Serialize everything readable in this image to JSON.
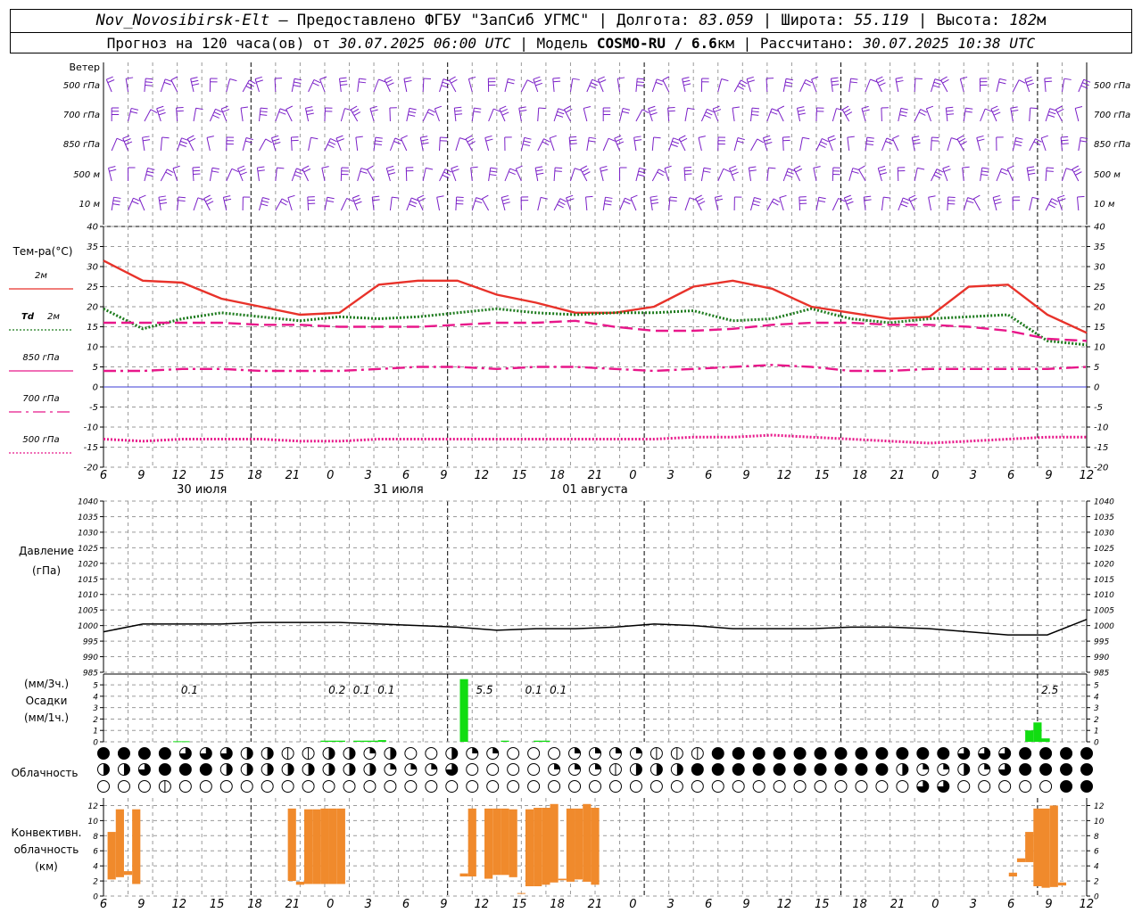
{
  "header": {
    "station": "Nov_Novosibirsk-Elt",
    "provided_by": "Предоставлено ФГБУ \"ЗапСиб УГМС\"",
    "lon_label": "Долгота:",
    "lon": "83.059",
    "lat_label": "Широта:",
    "lat": "55.119",
    "alt_label": "Высота:",
    "alt": "182",
    "alt_unit": "м",
    "forecast_label": "Прогноз на 120 часа(ов) от",
    "forecast_time": "30.07.2025 06:00 UTC",
    "model_label": "Модель",
    "model": "COSMO-RU / 6.6",
    "model_unit": "км",
    "computed_label": "Рассчитано:",
    "computed_time": "30.07.2025 10:38 UTC"
  },
  "chart_data": [
    {
      "type": "barbs",
      "title": "Ветер",
      "levels": [
        "500 гПа",
        "700 гПа",
        "850 гПа",
        "500 м",
        "10 м"
      ]
    },
    {
      "type": "line",
      "title": "Тем-ра(°C)",
      "ylim": [
        -20,
        40
      ],
      "yticks": [
        40,
        35,
        30,
        25,
        20,
        15,
        10,
        5,
        0,
        -5,
        -10,
        -15,
        -20
      ],
      "x_hours": [
        0,
        6,
        12,
        18,
        24,
        30,
        36,
        42,
        48,
        54,
        60,
        66,
        72,
        78,
        84,
        90,
        96,
        102,
        108,
        114,
        120
      ],
      "series": [
        {
          "name": "2м",
          "color": "#e8322a",
          "dash": "solid",
          "values": [
            31.5,
            26.5,
            26,
            22,
            20,
            18,
            18.5,
            25.5,
            26.5,
            26.5,
            23,
            21,
            18.5,
            18.5,
            20,
            25,
            26.5,
            24.5,
            20,
            18.5,
            17,
            17.5,
            25,
            25.5,
            18,
            13.5
          ]
        },
        {
          "name": "Td 2м",
          "color": "#1c7a1c",
          "dash": "dotted",
          "values": [
            19.5,
            14.5,
            17,
            18.5,
            17.5,
            16.5,
            17.5,
            17,
            17.5,
            18.5,
            19.5,
            18.5,
            18,
            18.5,
            18.5,
            19,
            16.5,
            17,
            19.5,
            17,
            16,
            17,
            17.5,
            18,
            11.5,
            10.5
          ]
        },
        {
          "name": "850 гПа",
          "color": "#e8178a",
          "dash": "longdash",
          "values": [
            16,
            16,
            16,
            16,
            15.5,
            15.5,
            15,
            15,
            15,
            15.5,
            16,
            16,
            16.5,
            15,
            14,
            14,
            14.5,
            15.5,
            16,
            16,
            15.5,
            15.5,
            15,
            14,
            12,
            11.5
          ]
        },
        {
          "name": "700 гПа",
          "color": "#e8178a",
          "dash": "dashdot",
          "values": [
            4,
            4,
            4.5,
            4.5,
            4,
            4,
            4,
            4.5,
            5,
            5,
            4.5,
            5,
            5,
            4.5,
            4,
            4.5,
            5,
            5.5,
            5,
            4,
            4,
            4.5,
            4.5,
            4.5,
            4.5,
            5
          ]
        },
        {
          "name": "500 гПа",
          "color": "#e8178a",
          "dash": "dotted",
          "values": [
            -13,
            -13.5,
            -13,
            -13,
            -13,
            -13.5,
            -13.5,
            -13,
            -13,
            -13,
            -13,
            -13,
            -13,
            -13,
            -13,
            -12.5,
            -12.5,
            -12,
            -12.5,
            -13,
            -13.5,
            -14,
            -13.5,
            -13,
            -12.5,
            -12.5
          ]
        }
      ]
    },
    {
      "type": "line",
      "title": "Давление",
      "unit": "(гПа)",
      "ylim": [
        985,
        1040
      ],
      "yticks": [
        1040,
        1035,
        1030,
        1025,
        1020,
        1015,
        1010,
        1005,
        1000,
        995,
        990,
        985
      ],
      "x_hours": [
        0,
        6,
        12,
        18,
        24,
        30,
        36,
        42,
        48,
        54,
        60,
        66,
        72,
        78,
        84,
        90,
        96,
        102,
        108,
        114,
        120
      ],
      "series": [
        {
          "name": "",
          "color": "#000000",
          "dash": "solid",
          "values": [
            998,
            1000.5,
            1000.5,
            1000.5,
            1001,
            1001,
            1001,
            1000.5,
            1000,
            999.5,
            998.5,
            999,
            999,
            999.5,
            1000.5,
            1000,
            999,
            999,
            999,
            999.5,
            999.5,
            999,
            998,
            997,
            997,
            1002
          ]
        }
      ]
    },
    {
      "type": "bar",
      "title": "Осадки",
      "units": [
        "(мм/3ч.)",
        "(мм/1ч.)"
      ],
      "ylim": [
        0,
        5
      ],
      "yticks": [
        5,
        4,
        3,
        2,
        1,
        0
      ],
      "bars": [
        {
          "hour": 9,
          "value": 0.05
        },
        {
          "hour": 10,
          "value": 0.05
        },
        {
          "hour": 27,
          "value": 0.1
        },
        {
          "hour": 28,
          "value": 0.1
        },
        {
          "hour": 29,
          "value": 0.1
        },
        {
          "hour": 31,
          "value": 0.1
        },
        {
          "hour": 32,
          "value": 0.1
        },
        {
          "hour": 33,
          "value": 0.1
        },
        {
          "hour": 34,
          "value": 0.15
        },
        {
          "hour": 44,
          "value": 5.5
        },
        {
          "hour": 49,
          "value": 0.1
        },
        {
          "hour": 53,
          "value": 0.1
        },
        {
          "hour": 54,
          "value": 0.1
        },
        {
          "hour": 113,
          "value": 1.0
        },
        {
          "hour": 114,
          "value": 1.7
        },
        {
          "hour": 115,
          "value": 0.3
        }
      ],
      "totals": [
        {
          "hour": 10.5,
          "label": "0.1"
        },
        {
          "hour": 28.5,
          "label": "0.2"
        },
        {
          "hour": 31.5,
          "label": "0.1"
        },
        {
          "hour": 34.5,
          "label": "0.1"
        },
        {
          "hour": 46.5,
          "label": "5.5"
        },
        {
          "hour": 52.5,
          "label": "0.1"
        },
        {
          "hour": 55.5,
          "label": "0.1"
        },
        {
          "hour": 115.5,
          "label": "2.5"
        }
      ]
    },
    {
      "type": "symbols",
      "title": "Облачность",
      "rows": [
        "CCCCDDDHHBBHHFHEEHFFEEEFFFFBBBCCCCCCCCCCCCDDDCCCCCCCCCCCCCCCCCCCCCCCCCCCCDFFHHEEEEEEDDDDDDDDCCBHEEEHH",
        "HHDCCCHHHHHHHHFFFDEEEEFFFBHHHCCCCCCCCCCHFFHFDCCCCCCCCCCCCCCCCCCCCCCCDDDCFFFFEEEDDHHBBHHHHCCCCCCCC",
        "EEEBEEEEEEEEEEEEEEEEEEEEEEEEEEEEEEEEEEEEDDEEEEECCCCCCCCDDDEHHHHCCCHHHHHCCCCEEEEEEEEEEEEEEEEEEEEEEEHHCCCCCCCC"
      ]
    },
    {
      "type": "bar",
      "title": "Конвективн. облачность",
      "unit": "(км)",
      "ylim": [
        0,
        13
      ],
      "yticks": [
        12,
        10,
        8,
        6,
        4,
        2,
        0
      ],
      "bars": [
        {
          "h0": 0.5,
          "h1": 1.5,
          "base": 2.2,
          "top": 8.5
        },
        {
          "h0": 1.5,
          "h1": 2.5,
          "base": 2.5,
          "top": 11.5
        },
        {
          "h0": 2.5,
          "h1": 3.5,
          "base": 2.8,
          "top": 3.3
        },
        {
          "h0": 3.5,
          "h1": 4.5,
          "base": 1.6,
          "top": 11.5
        },
        {
          "h0": 22.5,
          "h1": 23.5,
          "base": 2.0,
          "top": 11.6
        },
        {
          "h0": 23.5,
          "h1": 24.5,
          "base": 1.5,
          "top": 1.9
        },
        {
          "h0": 24.5,
          "h1": 25.5,
          "base": 1.6,
          "top": 11.5
        },
        {
          "h0": 25.5,
          "h1": 26.5,
          "base": 1.6,
          "top": 11.5
        },
        {
          "h0": 26.5,
          "h1": 27.5,
          "base": 1.6,
          "top": 11.6
        },
        {
          "h0": 27.5,
          "h1": 28.5,
          "base": 1.6,
          "top": 11.6
        },
        {
          "h0": 28.5,
          "h1": 29.5,
          "base": 1.6,
          "top": 11.6
        },
        {
          "h0": 43.5,
          "h1": 44.5,
          "base": 2.6,
          "top": 3.0
        },
        {
          "h0": 44.5,
          "h1": 45.5,
          "base": 2.6,
          "top": 11.6
        },
        {
          "h0": 46.5,
          "h1": 47.5,
          "base": 2.3,
          "top": 11.6
        },
        {
          "h0": 47.5,
          "h1": 48.5,
          "base": 2.8,
          "top": 11.6
        },
        {
          "h0": 48.5,
          "h1": 49.5,
          "base": 2.8,
          "top": 11.6
        },
        {
          "h0": 49.5,
          "h1": 50.5,
          "base": 2.5,
          "top": 11.5
        },
        {
          "h0": 50.5,
          "h1": 51.5,
          "base": 0.3,
          "top": 0.4
        },
        {
          "h0": 51.5,
          "h1": 52.5,
          "base": 1.3,
          "top": 11.5
        },
        {
          "h0": 52.5,
          "h1": 53.5,
          "base": 1.3,
          "top": 11.7
        },
        {
          "h0": 53.5,
          "h1": 54.5,
          "base": 1.5,
          "top": 11.7
        },
        {
          "h0": 54.5,
          "h1": 55.5,
          "base": 1.8,
          "top": 12.2
        },
        {
          "h0": 55.5,
          "h1": 56.5,
          "base": 2.1,
          "top": 2.3
        },
        {
          "h0": 56.5,
          "h1": 57.5,
          "base": 1.9,
          "top": 11.6
        },
        {
          "h0": 57.5,
          "h1": 58.5,
          "base": 2.2,
          "top": 11.6
        },
        {
          "h0": 58.5,
          "h1": 59.5,
          "base": 1.9,
          "top": 12.2
        },
        {
          "h0": 59.5,
          "h1": 60.5,
          "base": 1.5,
          "top": 11.7
        },
        {
          "h0": 110.5,
          "h1": 111.5,
          "base": 2.6,
          "top": 3.1
        },
        {
          "h0": 111.5,
          "h1": 112.5,
          "base": 4.5,
          "top": 5.0
        },
        {
          "h0": 112.5,
          "h1": 113.5,
          "base": 4.5,
          "top": 8.5
        },
        {
          "h0": 113.5,
          "h1": 114.5,
          "base": 1.3,
          "top": 11.6
        },
        {
          "h0": 114.5,
          "h1": 115.5,
          "base": 1.1,
          "top": 11.6
        },
        {
          "h0": 115.5,
          "h1": 116.5,
          "base": 1.2,
          "top": 12.0
        },
        {
          "h0": 116.5,
          "h1": 117.5,
          "base": 1.4,
          "top": 1.8
        }
      ]
    }
  ],
  "time_axis": {
    "hour_labels": [
      "6",
      "9",
      "12",
      "15",
      "18",
      "21",
      "0",
      "3",
      "6",
      "9",
      "12",
      "15",
      "18",
      "21",
      "0",
      "3",
      "6",
      "9",
      "12",
      "15",
      "18",
      "21",
      "0",
      "3",
      "6",
      "9",
      "12"
    ],
    "day_labels": [
      {
        "hour": 9,
        "text": "30 июля"
      },
      {
        "hour": 33,
        "text": "31 июля"
      },
      {
        "hour": 57,
        "text": "01 августа"
      }
    ]
  },
  "legend": {
    "t2m": "2м",
    "td_prefix": "Td",
    "td_suffix": "2м",
    "t850": "850 гПа",
    "t700": "700 гПа",
    "t500": "500 гПа"
  },
  "colors": {
    "t2m": "#e8322a",
    "td": "#1c7a1c",
    "upper": "#e8178a",
    "precip": "#11dd11",
    "conv": "#f08a2c",
    "wind": "#7a1fc7",
    "zero_line": "#3b3bd6"
  }
}
